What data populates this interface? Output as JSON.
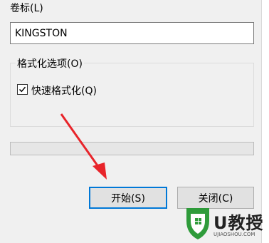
{
  "dialog": {
    "volume_label": "卷标(L)",
    "volume_value": "KINGSTON",
    "group_title": "格式化选项(O)",
    "quick_format_label": "快速格式化(Q)",
    "quick_format_checked": true,
    "progress_value": 0,
    "start_button": "开始(S)",
    "close_button": "关闭(C)"
  },
  "watermark": {
    "brand": "U教授",
    "url": "UJIAOSHOU.COM",
    "accent": "#2e9b3a"
  },
  "annotation": {
    "arrow_color": "#e8242a",
    "arrow_target": "start-button"
  }
}
